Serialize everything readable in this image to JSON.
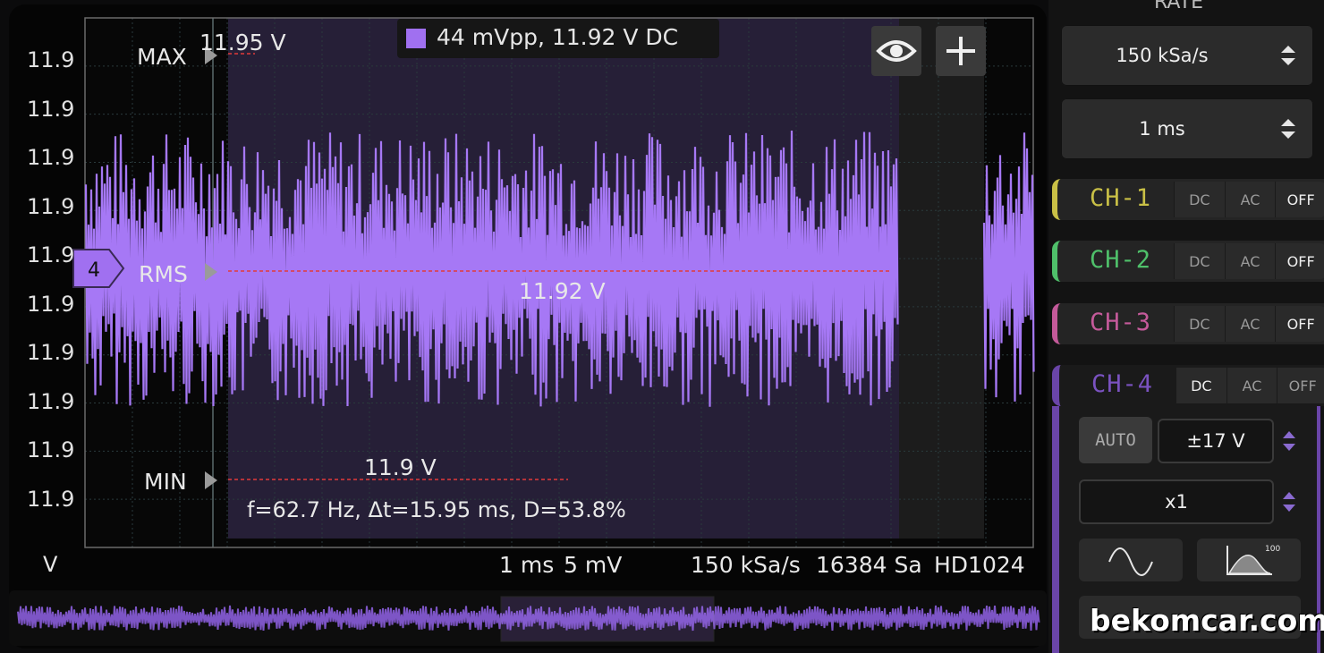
{
  "scope": {
    "y_ticks": [
      "11.9",
      "11.9",
      "11.9",
      "11.9",
      "11.9",
      "11.9",
      "11.9",
      "11.9",
      "11.9",
      "11.9"
    ],
    "y_unit": "V",
    "max_label": "MAX",
    "max_value": "11.95 V",
    "rms_label": "RMS",
    "rms_value": "11.92 V",
    "min_label": "MIN",
    "min_value": "11.9 V",
    "channel_marker": "4",
    "measurement": "f=62.7 Hz, Δt=15.95 ms, D=53.8%",
    "legend_text": "44 mVpp, 11.92 V DC",
    "time_div": "1 ms",
    "volt_div": "5 mV",
    "sample_rate": "150 kSa/s",
    "samples": "16384 Sa",
    "mode": "HD1024",
    "trace_color": "#a678f5"
  },
  "panel": {
    "rate_header": "RATE",
    "rate_value": "150 kSa/s",
    "timebase_value": "1 ms",
    "channels": [
      {
        "label": "CH-1",
        "dc": "DC",
        "ac": "AC",
        "off": "OFF",
        "color": "#c9c046"
      },
      {
        "label": "CH-2",
        "dc": "DC",
        "ac": "AC",
        "off": "OFF",
        "color": "#4fc06a"
      },
      {
        "label": "CH-3",
        "dc": "DC",
        "ac": "AC",
        "off": "OFF",
        "color": "#c45a9a"
      },
      {
        "label": "CH-4",
        "dc": "DC",
        "ac": "AC",
        "off": "OFF",
        "color": "#7a52c0"
      }
    ],
    "auto_label": "AUTO",
    "range_value": "±17 V",
    "probe_value": "x1",
    "histogram_label": "100"
  },
  "watermark": "bekomcar.com"
}
